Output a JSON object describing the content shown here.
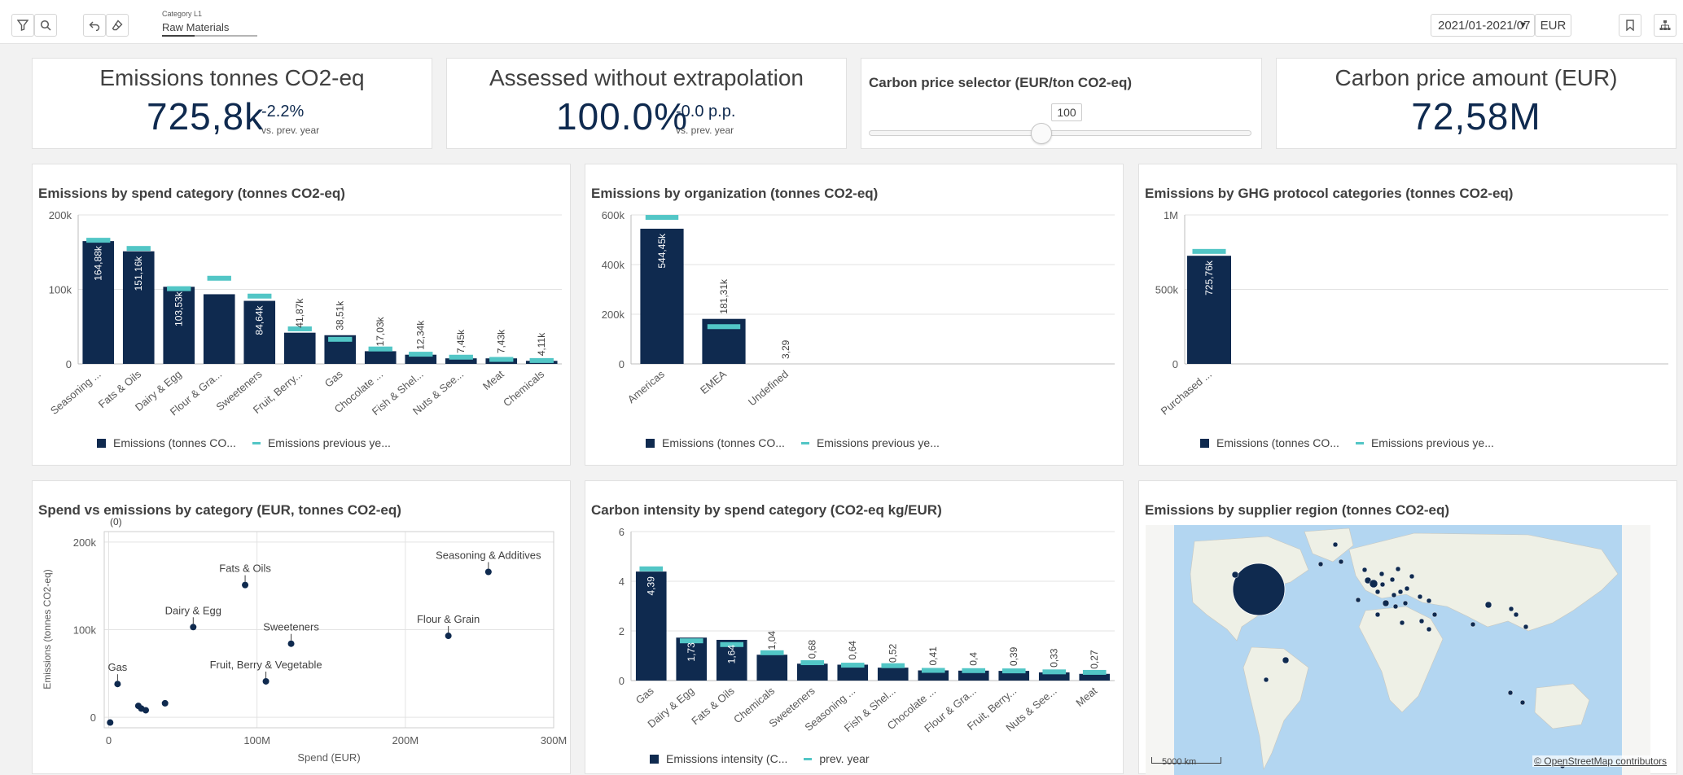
{
  "toolbar": {
    "filter_label": "Category L1",
    "filter_value": "Raw Materials",
    "date_range": "2021/01-2021/07",
    "currency": "EUR"
  },
  "colors": {
    "bar": "#0f2a4f",
    "prev": "#52c6c6",
    "grid": "#e3e3e3",
    "sea": "#b3d6f1",
    "land": "#eef0e6"
  },
  "kpis": {
    "emissions": {
      "title": "Emissions tonnes CO2-eq",
      "value": "725,8k",
      "delta": "-2.2%",
      "sub": "vs. prev. year"
    },
    "assessed": {
      "title": "Assessed without extrapolation",
      "value": "100.0%",
      "delta": "-0.0 p.p.",
      "sub": "vs. prev. year"
    },
    "slider": {
      "title": "Carbon price selector (EUR/ton CO2-eq)",
      "value": "100",
      "level": 0.45
    },
    "carbon": {
      "title": "Carbon price amount (EUR)",
      "value": "72,58M"
    }
  },
  "legend": {
    "emissions": "Emissions (tonnes CO...",
    "prev": "Emissions previous ye...",
    "intensity": "Emissions intensity (C...",
    "prev_short": "prev. year"
  },
  "chart_data": [
    {
      "id": "spend_cat",
      "type": "bar",
      "title": "Emissions by spend category (tonnes CO2-eq)",
      "categories": [
        "Seasoning ...",
        "Fats & Oils",
        "Dairy & Egg",
        "Flour & Gra...",
        "Sweeteners",
        "Fruit, Berry...",
        "Gas",
        "Chocolate ...",
        "Fish & Shel...",
        "Nuts & See...",
        "Meat",
        "Chemicals"
      ],
      "values": [
        164880,
        151160,
        103530,
        93500,
        84640,
        41870,
        38510,
        17030,
        12340,
        7450,
        7430,
        4110
      ],
      "labels": [
        "164,88k",
        "151,16k",
        "103,53k",
        "",
        "84,64k",
        "41,87k",
        "38,51k",
        "17,03k",
        "12,34k",
        "7,45k",
        "7,43k",
        "4,11k"
      ],
      "prev": [
        166000,
        155000,
        101000,
        115000,
        91000,
        47000,
        33000,
        20000,
        13000,
        9000,
        6000,
        4500
      ],
      "ticks": [
        {
          "v": 0,
          "t": "0"
        },
        {
          "v": 100000,
          "t": "100k"
        },
        {
          "v": 200000,
          "t": "200k"
        }
      ],
      "ylim": [
        0,
        200000
      ]
    },
    {
      "id": "org",
      "type": "bar",
      "title": "Emissions by organization (tonnes CO2-eq)",
      "categories": [
        "Americas",
        "EMEA",
        "Undefined"
      ],
      "values": [
        544450,
        181310,
        3.29
      ],
      "labels": [
        "544,45k",
        "181,31k",
        "3,29"
      ],
      "prev": [
        590000,
        150000,
        0
      ],
      "ticks": [
        {
          "v": 0,
          "t": "0"
        },
        {
          "v": 200000,
          "t": "200k"
        },
        {
          "v": 400000,
          "t": "400k"
        },
        {
          "v": 600000,
          "t": "600k"
        }
      ],
      "ylim": [
        0,
        600000
      ]
    },
    {
      "id": "ghg",
      "type": "bar",
      "title": "Emissions by GHG protocol categories (tonnes CO2-eq)",
      "categories": [
        "Purchased ..."
      ],
      "values": [
        725760
      ],
      "labels": [
        "725,76k"
      ],
      "prev": [
        755000
      ],
      "ticks": [
        {
          "v": 0,
          "t": "0"
        },
        {
          "v": 500000,
          "t": "500k"
        },
        {
          "v": 1000000,
          "t": "1M"
        }
      ],
      "ylim": [
        0,
        1000000
      ]
    },
    {
      "id": "scatter",
      "type": "scatter",
      "title": "Spend vs emissions by category (EUR, tonnes CO2-eq)",
      "xlabel": "Spend (EUR)",
      "ylabel": "Emissions (tonnes CO2-eq)",
      "note": "(0)",
      "xticks": [
        {
          "v": 0,
          "t": "0"
        },
        {
          "v": 100000000,
          "t": "100M"
        },
        {
          "v": 200000000,
          "t": "200M"
        },
        {
          "v": 300000000,
          "t": "300M"
        }
      ],
      "yticks": [
        {
          "v": 0,
          "t": "0"
        },
        {
          "v": 100000,
          "t": "100k"
        },
        {
          "v": 200000,
          "t": "200k"
        }
      ],
      "xlim": [
        -3000000,
        300000000
      ],
      "ylim": [
        -12000,
        212000
      ],
      "points": [
        {
          "label": "Seasoning & Additives",
          "x": 256000000,
          "y": 166000
        },
        {
          "label": "Fats & Oils",
          "x": 92000000,
          "y": 151000
        },
        {
          "label": "Dairy & Egg",
          "x": 57000000,
          "y": 103000
        },
        {
          "label": "Sweeteners",
          "x": 123000000,
          "y": 84000
        },
        {
          "label": "Flour & Grain",
          "x": 229000000,
          "y": 93000
        },
        {
          "label": "Fruit, Berry & Vegetable",
          "x": 106000000,
          "y": 41000
        },
        {
          "label": "Gas",
          "x": 6000000,
          "y": 38000
        },
        {
          "label": "",
          "x": 20000000,
          "y": 13000
        },
        {
          "label": "",
          "x": 22000000,
          "y": 10000
        },
        {
          "label": "",
          "x": 25000000,
          "y": 8000
        },
        {
          "label": "",
          "x": 38000000,
          "y": 16000
        },
        {
          "label": "",
          "x": 1000000,
          "y": -6000
        }
      ]
    },
    {
      "id": "intensity",
      "type": "bar",
      "title": "Carbon intensity by spend category (CO2-eq kg/EUR)",
      "categories": [
        "Gas",
        "Dairy & Egg",
        "Fats & Oils",
        "Chemicals",
        "Sweeteners",
        "Seasoning ...",
        "Fish & Shel...",
        "Chocolate ...",
        "Flour & Gra...",
        "Fruit, Berry...",
        "Nuts & See...",
        "Meat"
      ],
      "values": [
        4.39,
        1.73,
        1.64,
        1.04,
        0.68,
        0.64,
        0.52,
        0.41,
        0.4,
        0.39,
        0.33,
        0.27
      ],
      "labels": [
        "4,39",
        "1,73",
        "1,64",
        "1,04",
        "0,68",
        "0,64",
        "0,52",
        "0,41",
        "0,4",
        "0,39",
        "0,33",
        "0,27"
      ],
      "prev": [
        4.5,
        1.6,
        1.45,
        1.12,
        0.72,
        0.62,
        0.6,
        0.41,
        0.4,
        0.39,
        0.35,
        0.33
      ],
      "ticks": [
        {
          "v": 0,
          "t": "0"
        },
        {
          "v": 2,
          "t": "2"
        },
        {
          "v": 4,
          "t": "4"
        },
        {
          "v": 6,
          "t": "6"
        }
      ],
      "ylim": [
        0,
        6
      ]
    }
  ],
  "map": {
    "title": "Emissions by supplier region (tonnes CO2-eq)",
    "scale": "5000 km",
    "attribution": "© OpenStreetMap contributors"
  }
}
